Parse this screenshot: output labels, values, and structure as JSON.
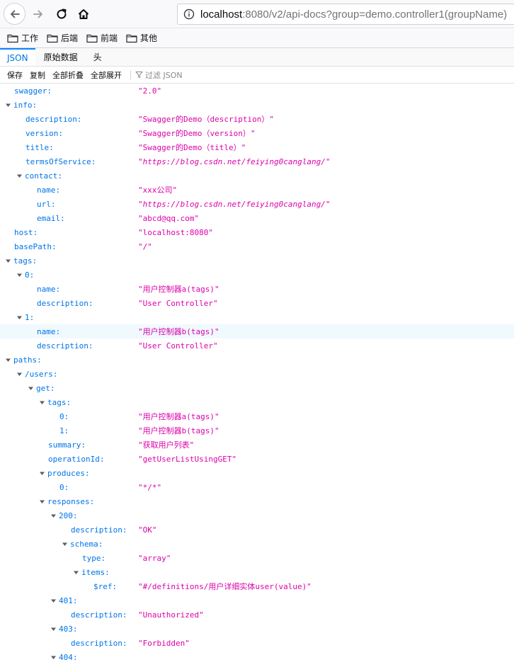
{
  "browser": {
    "url_host": "localhost",
    "url_rest": ":8080/v2/api-docs?group=demo.controller1(groupName)"
  },
  "bookmarks": [
    {
      "label": "工作"
    },
    {
      "label": "后端"
    },
    {
      "label": "前端"
    },
    {
      "label": "其他"
    }
  ],
  "tabs": [
    {
      "label": "JSON",
      "active": true
    },
    {
      "label": "原始数据",
      "active": false
    },
    {
      "label": "头",
      "active": false
    }
  ],
  "toolbar": {
    "save": "保存",
    "copy": "复制",
    "collapse_all": "全部折叠",
    "expand_all": "全部展开",
    "filter_placeholder": "过滤 JSON"
  },
  "accent": "#0074e8",
  "value_color": "#dd00a9",
  "rows": [
    {
      "key": "swagger:",
      "depth": 0,
      "twisty": false,
      "value": "\"2.0\""
    },
    {
      "key": "info:",
      "depth": 0,
      "twisty": true,
      "value": ""
    },
    {
      "key": "description:",
      "depth": 1,
      "twisty": false,
      "value": "\"Swagger的Demo（description）\""
    },
    {
      "key": "version:",
      "depth": 1,
      "twisty": false,
      "value": "\"Swagger的Demo（version）\""
    },
    {
      "key": "title:",
      "depth": 1,
      "twisty": false,
      "value": "\"Swagger的Demo（title）\""
    },
    {
      "key": "termsOfService:",
      "depth": 1,
      "twisty": false,
      "value": "\"https://blog.csdn.net/feiying0canglang/\"",
      "url": true
    },
    {
      "key": "contact:",
      "depth": 1,
      "twisty": true,
      "value": ""
    },
    {
      "key": "name:",
      "depth": 2,
      "twisty": false,
      "value": "\"xxx公司\""
    },
    {
      "key": "url:",
      "depth": 2,
      "twisty": false,
      "value": "\"https://blog.csdn.net/feiying0canglang/\"",
      "url": true
    },
    {
      "key": "email:",
      "depth": 2,
      "twisty": false,
      "value": "\"abcd@qq.com\""
    },
    {
      "key": "host:",
      "depth": 0,
      "twisty": false,
      "value": "\"localhost:8080\""
    },
    {
      "key": "basePath:",
      "depth": 0,
      "twisty": false,
      "value": "\"/\""
    },
    {
      "key": "tags:",
      "depth": 0,
      "twisty": true,
      "value": ""
    },
    {
      "key": "0:",
      "depth": 1,
      "twisty": true,
      "value": ""
    },
    {
      "key": "name:",
      "depth": 2,
      "twisty": false,
      "value": "\"用户控制器a(tags)\""
    },
    {
      "key": "description:",
      "depth": 2,
      "twisty": false,
      "value": "\"User Controller\""
    },
    {
      "key": "1:",
      "depth": 1,
      "twisty": true,
      "value": ""
    },
    {
      "key": "name:",
      "depth": 2,
      "twisty": false,
      "value": "\"用户控制器b(tags)\"",
      "selected": true
    },
    {
      "key": "description:",
      "depth": 2,
      "twisty": false,
      "value": "\"User Controller\""
    },
    {
      "key": "paths:",
      "depth": 0,
      "twisty": true,
      "value": ""
    },
    {
      "key": "/users:",
      "depth": 1,
      "twisty": true,
      "value": ""
    },
    {
      "key": "get:",
      "depth": 2,
      "twisty": true,
      "value": ""
    },
    {
      "key": "tags:",
      "depth": 3,
      "twisty": true,
      "value": ""
    },
    {
      "key": "0:",
      "depth": 4,
      "twisty": false,
      "value": "\"用户控制器a(tags)\""
    },
    {
      "key": "1:",
      "depth": 4,
      "twisty": false,
      "value": "\"用户控制器b(tags)\""
    },
    {
      "key": "summary:",
      "depth": 3,
      "twisty": false,
      "value": "\"获取用户列表\""
    },
    {
      "key": "operationId:",
      "depth": 3,
      "twisty": false,
      "value": "\"getUserListUsingGET\""
    },
    {
      "key": "produces:",
      "depth": 3,
      "twisty": true,
      "value": ""
    },
    {
      "key": "0:",
      "depth": 4,
      "twisty": false,
      "value": "\"*/*\""
    },
    {
      "key": "responses:",
      "depth": 3,
      "twisty": true,
      "value": ""
    },
    {
      "key": "200:",
      "depth": 4,
      "twisty": true,
      "value": ""
    },
    {
      "key": "description:",
      "depth": 5,
      "twisty": false,
      "value": "\"OK\""
    },
    {
      "key": "schema:",
      "depth": 5,
      "twisty": true,
      "value": ""
    },
    {
      "key": "type:",
      "depth": 6,
      "twisty": false,
      "value": "\"array\""
    },
    {
      "key": "items:",
      "depth": 6,
      "twisty": true,
      "value": ""
    },
    {
      "key": "$ref:",
      "depth": 7,
      "twisty": false,
      "value": "\"#/definitions/用户详细实体user(value)\""
    },
    {
      "key": "401:",
      "depth": 4,
      "twisty": true,
      "value": ""
    },
    {
      "key": "description:",
      "depth": 5,
      "twisty": false,
      "value": "\"Unauthorized\""
    },
    {
      "key": "403:",
      "depth": 4,
      "twisty": true,
      "value": ""
    },
    {
      "key": "description:",
      "depth": 5,
      "twisty": false,
      "value": "\"Forbidden\""
    },
    {
      "key": "404:",
      "depth": 4,
      "twisty": true,
      "value": ""
    }
  ]
}
